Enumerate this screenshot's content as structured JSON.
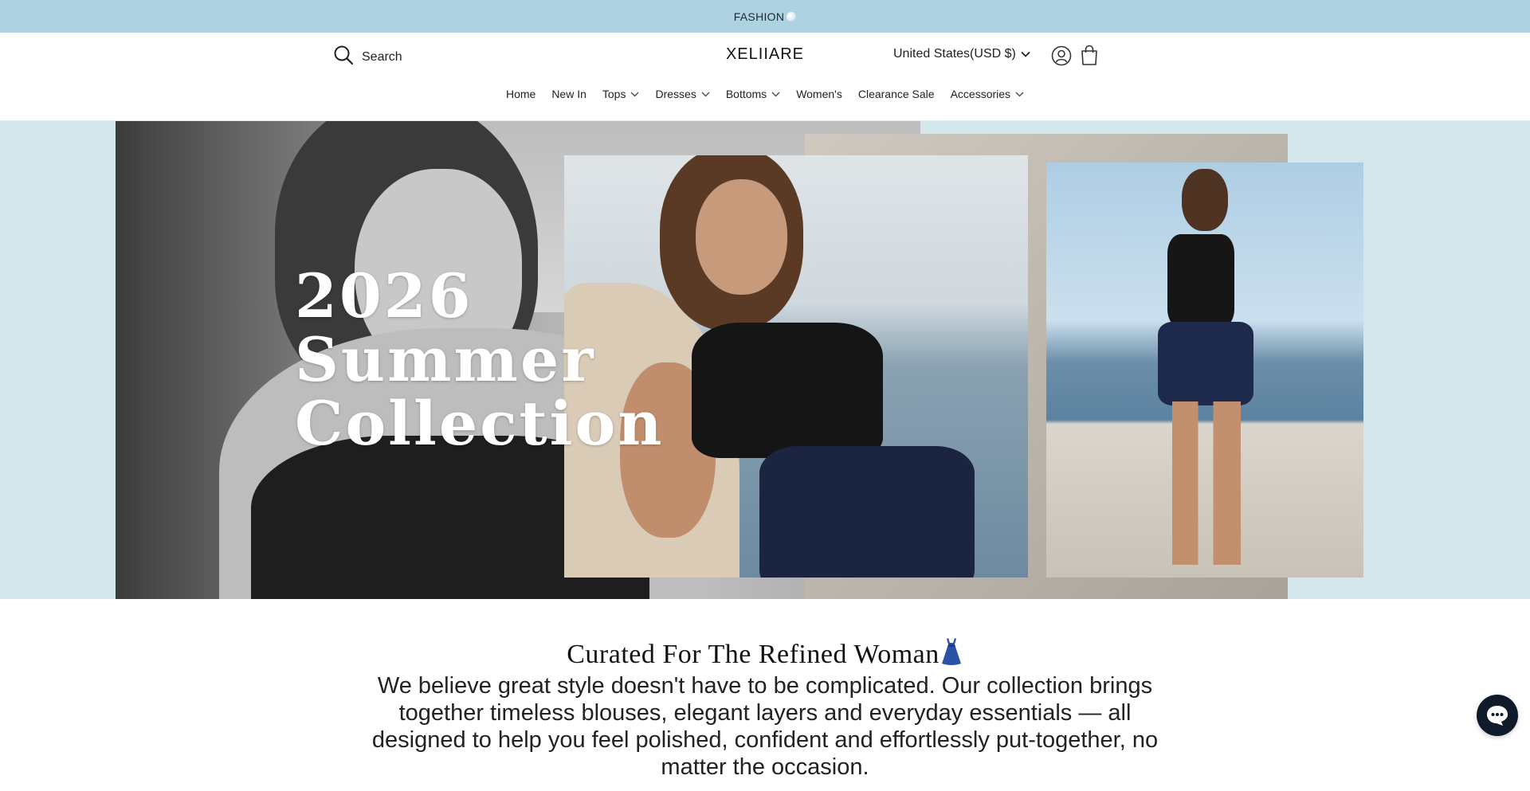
{
  "announcement": {
    "text": "FASHION",
    "icon": "moon-icon"
  },
  "header": {
    "search_label": "Search",
    "logo": "XELIIARE",
    "country_selector": "United States(USD $)"
  },
  "nav": {
    "items": [
      {
        "label": "Home",
        "has_dropdown": false
      },
      {
        "label": "New In",
        "has_dropdown": false
      },
      {
        "label": "Tops",
        "has_dropdown": true
      },
      {
        "label": "Dresses",
        "has_dropdown": true
      },
      {
        "label": "Bottoms",
        "has_dropdown": true
      },
      {
        "label": "Women's",
        "has_dropdown": false
      },
      {
        "label": "Clearance Sale",
        "has_dropdown": false
      },
      {
        "label": "Accessories",
        "has_dropdown": true
      }
    ]
  },
  "hero": {
    "headline_lines": [
      "2026",
      "Summer",
      "Collection"
    ]
  },
  "intro": {
    "title": "Curated For The Refined Woman",
    "title_icon": "dress-icon",
    "body": "We believe great style doesn't have to be complicated. Our collection brings together timeless blouses, elegant layers and everyday essentials — all designed to help you feel polished, confident and effortlessly put-together, no matter the occasion."
  },
  "colors": {
    "announcement_bg": "#add3e3",
    "hero_bg": "#d3e6ec",
    "chat_button": "#0f1a2a"
  }
}
